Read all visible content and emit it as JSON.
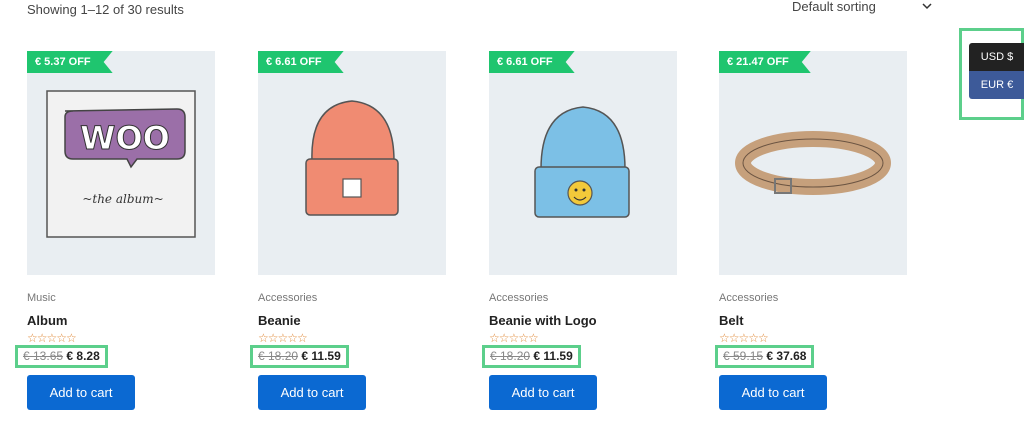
{
  "results_count": "Showing 1–12 of 30 results",
  "sorting": {
    "selected": "Default sorting"
  },
  "currency": {
    "options": [
      "USD $",
      "EUR €"
    ]
  },
  "colors": {
    "accent": "#0b69d2",
    "badge": "#1fc56f",
    "highlight": "#5ccf8b"
  },
  "products": [
    {
      "badge": "€ 5.37 OFF",
      "category": "Music",
      "title": "Album",
      "rating": 0,
      "stars": "☆☆☆☆☆",
      "old_price": "€ 13.65",
      "new_price": "€ 8.28",
      "button": "Add to cart",
      "image": {
        "text_main": "WOO",
        "text_caption": "~the album~"
      }
    },
    {
      "badge": "€ 6.61 OFF",
      "category": "Accessories",
      "title": "Beanie",
      "rating": 0,
      "stars": "☆☆☆☆☆",
      "old_price": "€ 18.20",
      "new_price": "€ 11.59",
      "button": "Add to cart",
      "image": "beanie-orange"
    },
    {
      "badge": "€ 6.61 OFF",
      "category": "Accessories",
      "title": "Beanie with Logo",
      "rating": 0,
      "stars": "☆☆☆☆☆",
      "old_price": "€ 18.20",
      "new_price": "€ 11.59",
      "button": "Add to cart",
      "image": "beanie-blue-logo"
    },
    {
      "badge": "€ 21.47 OFF",
      "category": "Accessories",
      "title": "Belt",
      "rating": 0,
      "stars": "☆☆☆☆☆",
      "old_price": "€ 59.15",
      "new_price": "€ 37.68",
      "button": "Add to cart",
      "image": "belt"
    }
  ]
}
